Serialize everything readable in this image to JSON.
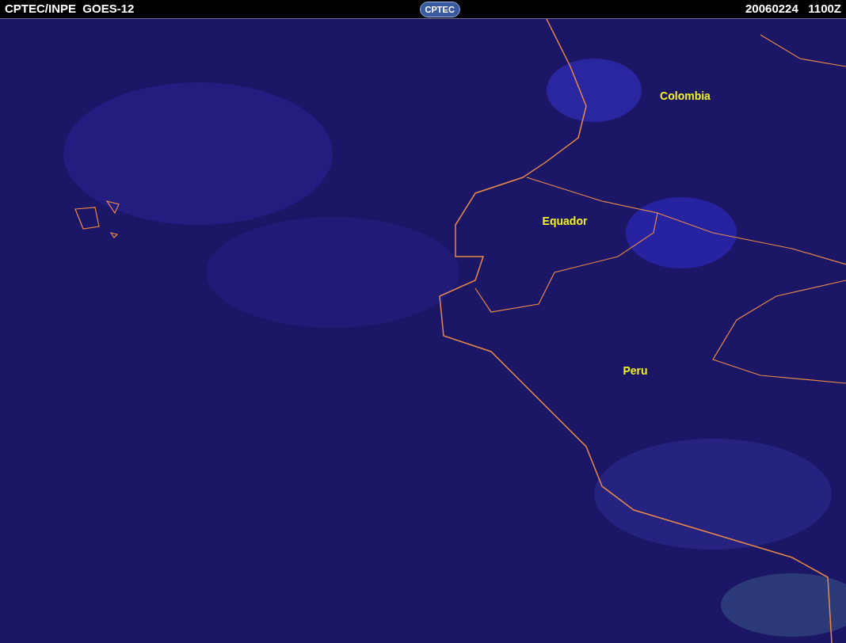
{
  "header": {
    "source": "CPTEC/INPE  GOES-12",
    "logo": "CPTEC",
    "timestamp": "20060224   1100Z"
  },
  "map": {
    "labels": [
      "Colombia",
      "Equador",
      "Peru"
    ]
  }
}
